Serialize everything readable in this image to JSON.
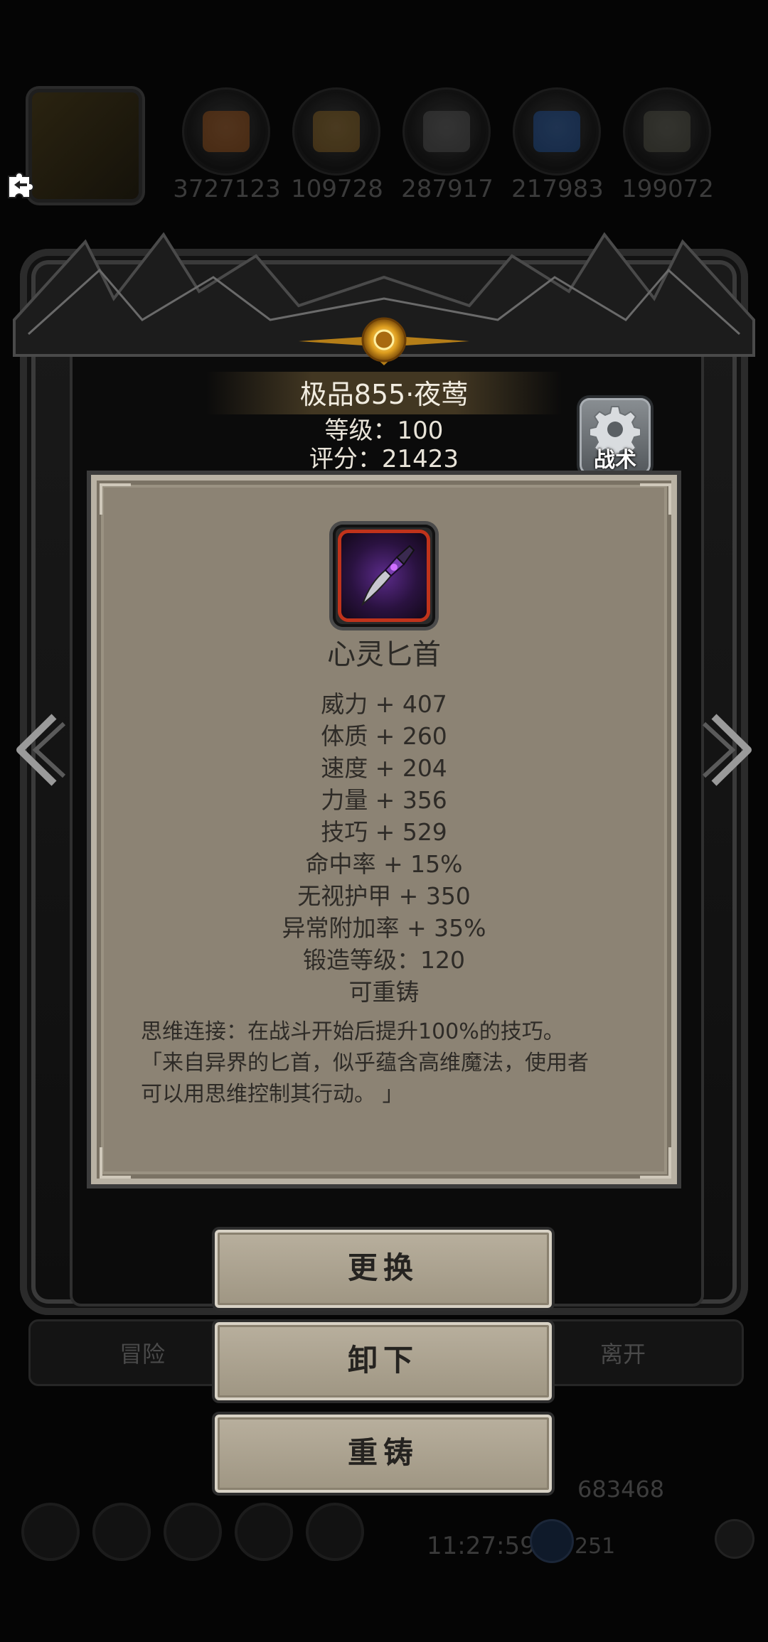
{
  "hud": {
    "resources": [
      "3727123",
      "109728",
      "287917",
      "217983",
      "199072"
    ],
    "resource_icons": [
      "fruit-icon",
      "wood-icon",
      "stone-icon",
      "crystal-icon",
      "ore-icon"
    ]
  },
  "equipment": {
    "title": "极品855·夜莺",
    "level": "等级：100",
    "score": "评分：21423",
    "tactics_label": "战术"
  },
  "item": {
    "name": "心灵匕首",
    "stats": [
      "威力 + 407",
      "体质 + 260",
      "速度 + 204",
      "力量 + 356",
      "技巧 + 529",
      "命中率 + 15%",
      "无视护甲 + 350",
      "异常附加率 + 35%",
      "锻造等级：120",
      "可重铸"
    ],
    "description": [
      "思维连接：在战斗开始后提升100%的技巧。",
      "「来自异界的匕首，似乎蕴含高维魔法，使用者",
      "可以用思维控制其行动。 」"
    ]
  },
  "actions": {
    "replace": "更换",
    "unequip": "卸下",
    "reforge": "重铸"
  },
  "background": {
    "left_label": "冒险",
    "right_label": "离开",
    "clock": "11:27:59",
    "coins": "683468",
    "gems": "251"
  },
  "colors": {
    "parchment": "#8c8374",
    "button": "#b0a794",
    "frame": "#2b2b2b",
    "item_border": "#c0331b"
  }
}
